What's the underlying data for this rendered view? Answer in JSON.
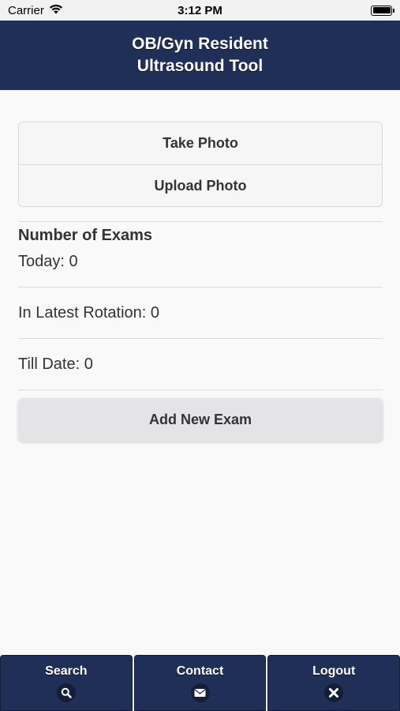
{
  "status_bar": {
    "carrier": "Carrier",
    "time": "3:12 PM"
  },
  "header": {
    "title_line1": "OB/Gyn Resident",
    "title_line2": "Ultrasound Tool"
  },
  "photo_actions": {
    "take_photo": "Take Photo",
    "upload_photo": "Upload Photo"
  },
  "exams": {
    "section_title": "Number of Exams",
    "today": "Today: 0",
    "latest_rotation": "In Latest Rotation: 0",
    "till_date": "Till Date: 0"
  },
  "add_exam_label": "Add New Exam",
  "bottom_nav": {
    "search": {
      "label": "Search",
      "icon": "search-icon"
    },
    "contact": {
      "label": "Contact",
      "icon": "envelope-icon"
    },
    "logout": {
      "label": "Logout",
      "icon": "close-icon"
    }
  },
  "colors": {
    "header_bg": "#1f2f57",
    "page_bg": "#f9f9f9"
  }
}
